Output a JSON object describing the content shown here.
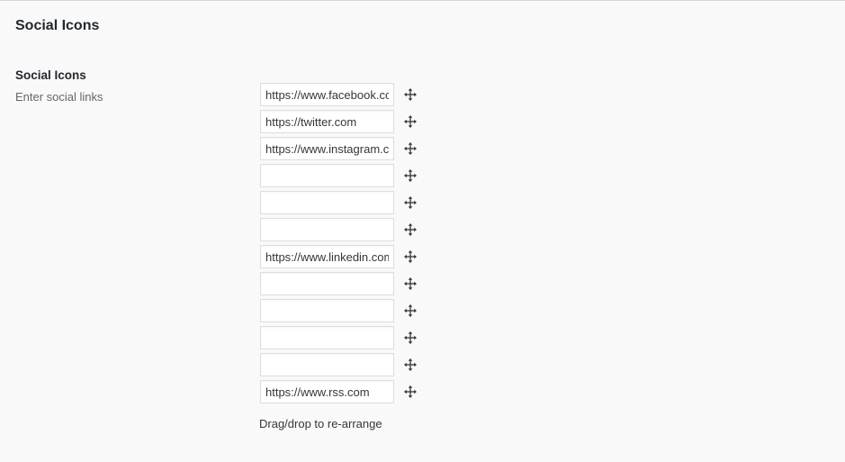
{
  "section": {
    "title": "Social Icons"
  },
  "field": {
    "title": "Social Icons",
    "description": "Enter social links"
  },
  "links": [
    {
      "value": "https://www.facebook.com"
    },
    {
      "value": "https://twitter.com"
    },
    {
      "value": "https://www.instagram.com"
    },
    {
      "value": ""
    },
    {
      "value": ""
    },
    {
      "value": ""
    },
    {
      "value": "https://www.linkedin.com"
    },
    {
      "value": ""
    },
    {
      "value": ""
    },
    {
      "value": ""
    },
    {
      "value": ""
    },
    {
      "value": "https://www.rss.com"
    }
  ],
  "handle_icon": "move-arrows-icon",
  "hint": "Drag/drop to re-arrange"
}
